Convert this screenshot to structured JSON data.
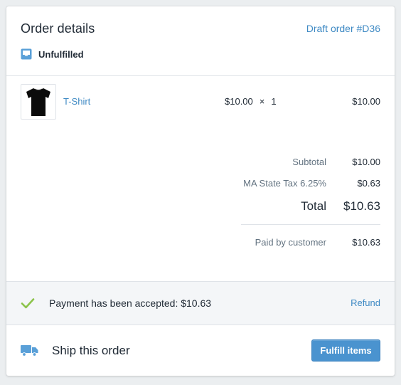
{
  "header": {
    "title": "Order details",
    "draft_link": "Draft order #D36",
    "status_label": "Unfulfilled"
  },
  "line_item": {
    "product_name": "T-Shirt",
    "unit_price": "$10.00",
    "times": "×",
    "quantity": "1",
    "line_total": "$10.00"
  },
  "totals": {
    "subtotal_label": "Subtotal",
    "subtotal_value": "$10.00",
    "tax_label": "MA State Tax 6.25%",
    "tax_value": "$0.63",
    "total_label": "Total",
    "total_value": "$10.63",
    "paid_label": "Paid by customer",
    "paid_value": "$10.63"
  },
  "payment": {
    "message": "Payment has been accepted: $10.63",
    "refund_label": "Refund"
  },
  "shipping": {
    "message": "Ship this order",
    "fulfill_label": "Fulfill items"
  },
  "colors": {
    "link": "#3f8ac4",
    "status_icon": "#5aa0d8",
    "check_icon": "#8bc34a",
    "button": "#4a93cf"
  },
  "icons": {
    "status": "inbox-icon",
    "payment": "checkmark-icon",
    "shipping": "truck-icon"
  }
}
